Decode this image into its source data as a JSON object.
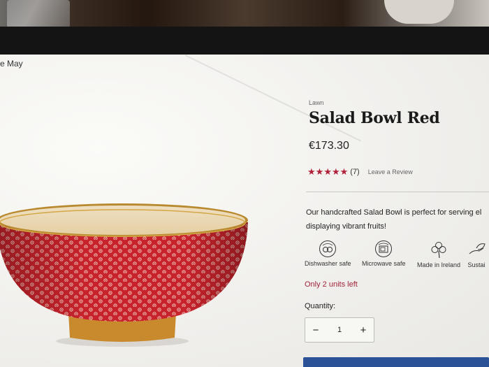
{
  "banner": {
    "text": "e May"
  },
  "product": {
    "brand": "Lawn",
    "title": "Salad Bowl Red",
    "price": "€173.30",
    "rating": {
      "stars": 5,
      "count": "(7)",
      "review_link": "Leave a Review"
    },
    "description": [
      "Our handcrafted Salad Bowl is perfect for serving el",
      "displaying vibrant fruits!"
    ],
    "features": [
      {
        "icon": "dishwasher-safe-icon",
        "label": "Dishwasher safe"
      },
      {
        "icon": "microwave-safe-icon",
        "label": "Microwave safe"
      },
      {
        "icon": "shamrock-icon",
        "label": "Made in Ireland"
      },
      {
        "icon": "sustainable-icon",
        "label": "Sustai"
      }
    ],
    "stock": "Only 2 units left",
    "quantity": {
      "label": "Quantity:",
      "value": "1",
      "minus": "−",
      "plus": "+"
    }
  },
  "colors": {
    "accent": "#b0223a",
    "bowl_red": "#c8232c",
    "button_blue": "#2b5296"
  }
}
